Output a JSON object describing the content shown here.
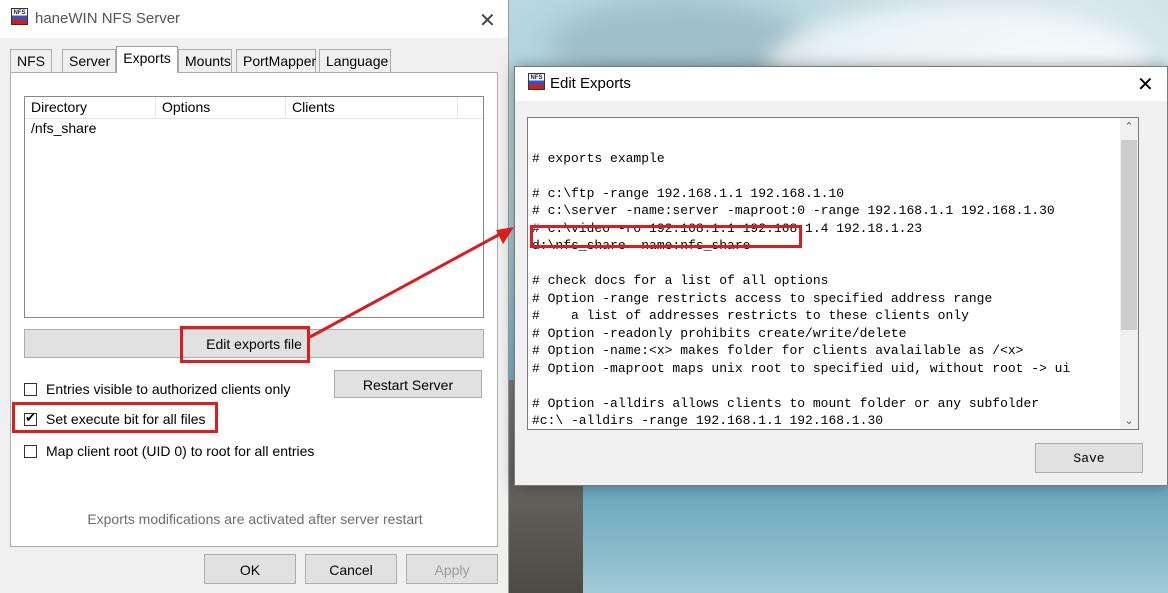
{
  "left_window": {
    "title": "haneWIN NFS Server",
    "app_icon_text": "NFS",
    "close_glyph": "✕",
    "tabs": [
      {
        "label": "NFS"
      },
      {
        "label": "Server"
      },
      {
        "label": "Exports"
      },
      {
        "label": "Mounts"
      },
      {
        "label": "PortMapper"
      },
      {
        "label": "Language"
      }
    ],
    "active_tab": "Exports",
    "exports_list": {
      "columns": [
        "Directory",
        "Options",
        "Clients"
      ],
      "rows": [
        {
          "directory": "/nfs_share",
          "options": "",
          "clients": ""
        }
      ]
    },
    "edit_exports_button": "Edit exports file",
    "restart_server_button": "Restart Server",
    "checkboxes": [
      {
        "label": "Entries visible to authorized clients only",
        "checked": false
      },
      {
        "label": "Set execute bit for all files",
        "checked": true
      },
      {
        "label": "Map client root (UID 0) to root for all entries",
        "checked": false
      }
    ],
    "note": "Exports modifications are activated after server restart",
    "ok_button": "OK",
    "cancel_button": "Cancel",
    "apply_button": "Apply",
    "check_glyph": "✔"
  },
  "edit_dialog": {
    "title": "Edit Exports",
    "app_icon_text": "NFS",
    "close_glyph": "✕",
    "lines": [
      "",
      "# exports example",
      "",
      "# c:\\ftp -range 192.168.1.1 192.168.1.10",
      "# c:\\server -name:server -maproot:0 -range 192.168.1.1 192.168.1.30",
      "# c:\\video -ro 192.168.1.1 192.168.1.4 192.18.1.23",
      "d:\\nfs_share -name:nfs_share",
      "",
      "# check docs for a list of all options",
      "# Option -range restricts access to specified address range",
      "#    a list of addresses restricts to these clients only",
      "# Option -readonly prohibits create/write/delete",
      "# Option -name:<x> makes folder for clients avalailable as /<x>",
      "# Option -maproot maps unix root to specified uid, without root -> ui",
      "",
      "# Option -alldirs allows clients to mount folder or any subfolder",
      "#c:\\ -alldirs -range 192.168.1.1 192.168.1.30"
    ],
    "scroll_up_glyph": "⌃",
    "scroll_down_glyph": "⌄",
    "save_button": "Save"
  },
  "annotation_color": "#d81e1e"
}
